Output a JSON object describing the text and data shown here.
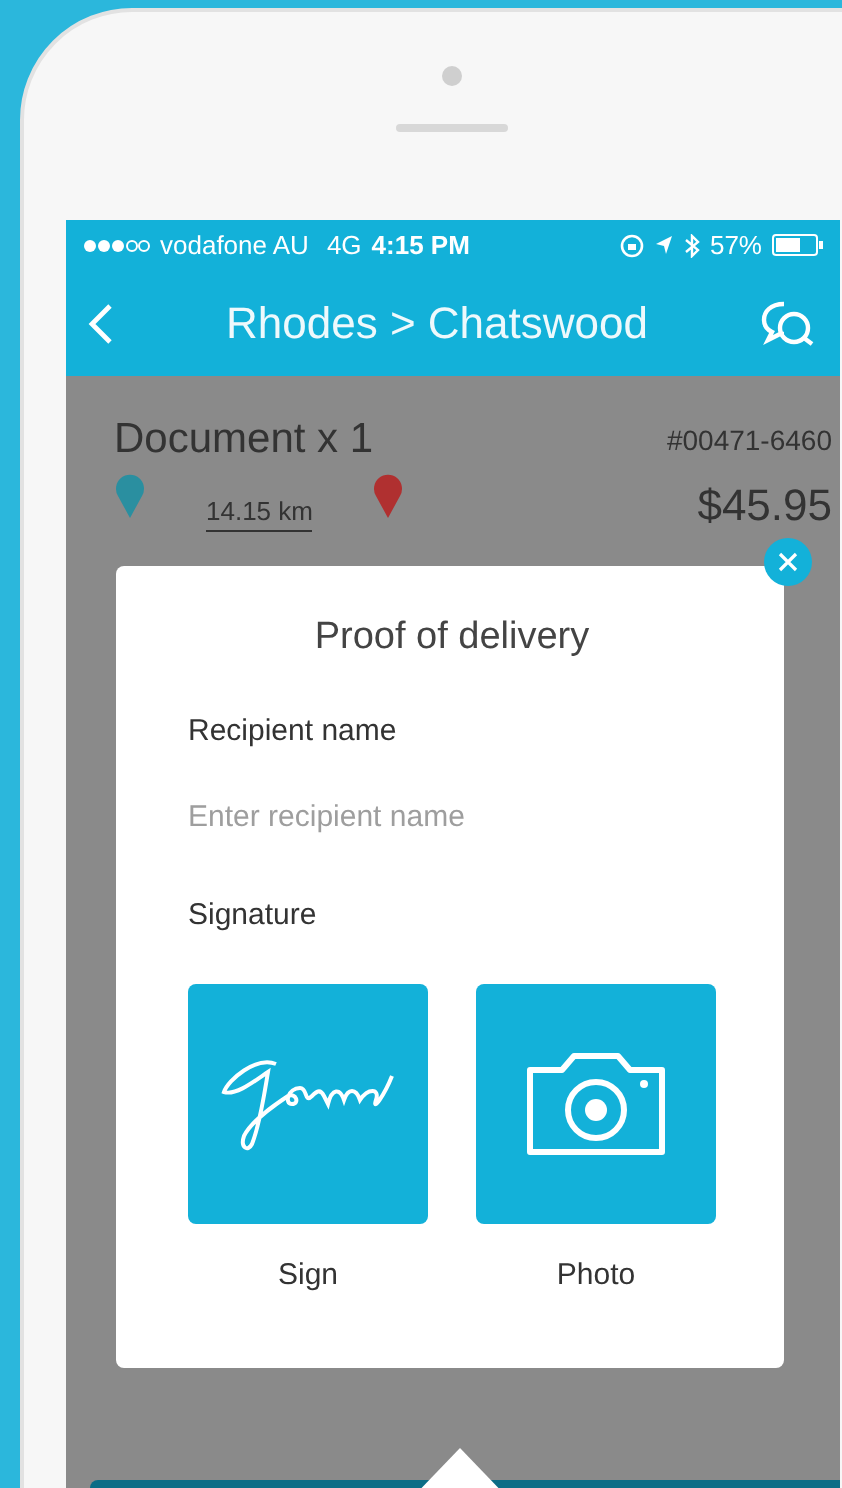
{
  "status_bar": {
    "carrier": "vodafone AU",
    "network": "4G",
    "time": "4:15 PM",
    "battery": "57%"
  },
  "nav": {
    "title": "Rhodes > Chatswood"
  },
  "order": {
    "item": "Document x 1",
    "number": "#00471-6460",
    "distance": "14.15 km",
    "price": "$45.95"
  },
  "dialog": {
    "title": "Proof of delivery",
    "recipient_label": "Recipient name",
    "recipient_placeholder": "Enter recipient name",
    "signature_label": "Signature",
    "options": [
      {
        "kind": "sign",
        "label": "Sign"
      },
      {
        "kind": "photo",
        "label": "Photo"
      }
    ]
  }
}
